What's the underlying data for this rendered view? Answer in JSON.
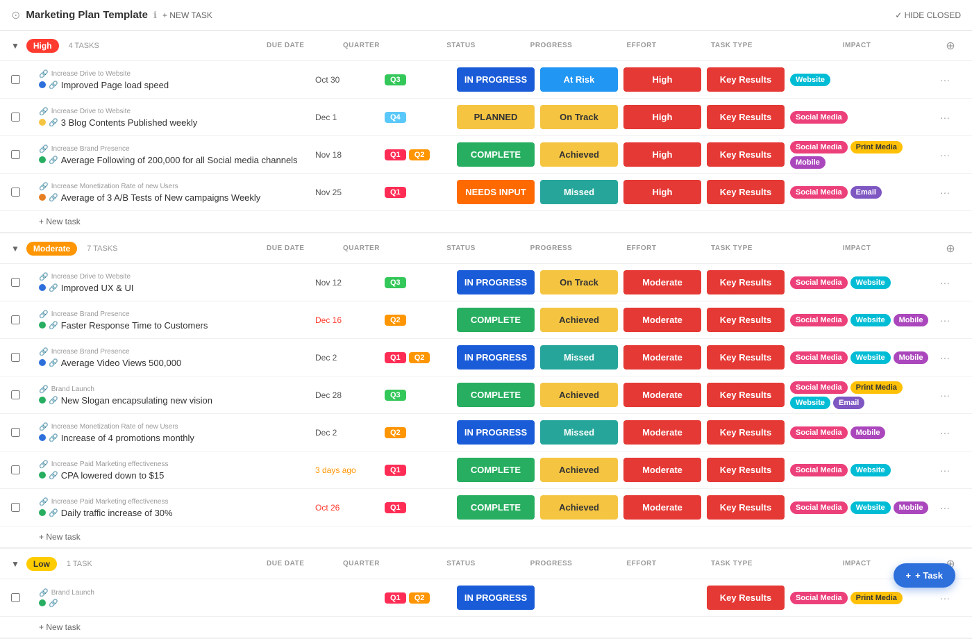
{
  "app": {
    "title": "Marketing Plan Template",
    "new_task_label": "+ NEW TASK",
    "hide_closed_label": "✓ HIDE CLOSED"
  },
  "col_headers": {
    "checkbox": "",
    "task": "",
    "due_date": "DUE DATE",
    "quarter": "QUARTER",
    "status": "STATUS",
    "progress": "PROGRESS",
    "effort": "EFFORT",
    "task_type": "TASK TYPE",
    "impact": "IMPACT",
    "actions": ""
  },
  "groups": [
    {
      "id": "high",
      "label": "High",
      "badge_class": "badge-high",
      "task_count": "4 TASKS",
      "tasks": [
        {
          "parent": "Increase Drive to Website",
          "name": "Improved Page load speed",
          "dot": "dot-blue",
          "due_date": "Oct 30",
          "due_class": "",
          "quarters": [
            {
              "label": "Q3",
              "class": "q3"
            }
          ],
          "status": "IN PROGRESS",
          "status_class": "status-in-progress",
          "progress": "At Risk",
          "progress_class": "prog-at-risk",
          "effort": "High",
          "effort_class": "effort-high",
          "task_type": "Key Results",
          "tt_class": "tt-key-results",
          "impact_tags": [
            {
              "label": "Website",
              "class": "imp-website"
            }
          ]
        },
        {
          "parent": "Increase Drive to Website",
          "name": "3 Blog Contents Published weekly",
          "dot": "dot-yellow",
          "due_date": "Dec 1",
          "due_class": "",
          "quarters": [
            {
              "label": "Q4",
              "class": "q4"
            }
          ],
          "status": "PLANNED",
          "status_class": "status-planned",
          "progress": "On Track",
          "progress_class": "prog-on-track",
          "effort": "High",
          "effort_class": "effort-high",
          "task_type": "Key Results",
          "tt_class": "tt-key-results",
          "impact_tags": [
            {
              "label": "Social Media",
              "class": "imp-social"
            }
          ]
        },
        {
          "parent": "Increase Brand Presence",
          "name": "Average Following of 200,000 for all Social media channels",
          "dot": "dot-green",
          "due_date": "Nov 18",
          "due_class": "",
          "quarters": [
            {
              "label": "Q1",
              "class": "q1"
            },
            {
              "label": "Q2",
              "class": "q2"
            }
          ],
          "status": "COMPLETE",
          "status_class": "status-complete",
          "progress": "Achieved",
          "progress_class": "prog-achieved",
          "effort": "High",
          "effort_class": "effort-high",
          "task_type": "Key Results",
          "tt_class": "tt-key-results",
          "impact_tags": [
            {
              "label": "Social Media",
              "class": "imp-social"
            },
            {
              "label": "Print Media",
              "class": "imp-print"
            },
            {
              "label": "Mobile",
              "class": "imp-mobile"
            }
          ]
        },
        {
          "parent": "Increase Monetization Rate of new Users",
          "name": "Average of 3 A/B Tests of New campaigns Weekly",
          "dot": "dot-orange",
          "due_date": "Nov 25",
          "due_class": "",
          "quarters": [
            {
              "label": "Q1",
              "class": "q1"
            }
          ],
          "status": "NEEDS INPUT",
          "status_class": "status-needs-input",
          "progress": "Missed",
          "progress_class": "prog-missed",
          "effort": "High",
          "effort_class": "effort-high",
          "task_type": "Key Results",
          "tt_class": "tt-key-results",
          "impact_tags": [
            {
              "label": "Social Media",
              "class": "imp-social"
            },
            {
              "label": "Email",
              "class": "imp-email"
            }
          ]
        }
      ]
    },
    {
      "id": "moderate",
      "label": "Moderate",
      "badge_class": "badge-moderate",
      "task_count": "7 TASKS",
      "tasks": [
        {
          "parent": "Increase Drive to Website",
          "name": "Improved UX & UI",
          "dot": "dot-blue",
          "due_date": "Nov 12",
          "due_class": "",
          "quarters": [
            {
              "label": "Q3",
              "class": "q3"
            }
          ],
          "status": "IN PROGRESS",
          "status_class": "status-in-progress",
          "progress": "On Track",
          "progress_class": "prog-on-track",
          "effort": "Moderate",
          "effort_class": "effort-moderate",
          "task_type": "Key Results",
          "tt_class": "tt-key-results",
          "impact_tags": [
            {
              "label": "Social Media",
              "class": "imp-social"
            },
            {
              "label": "Website",
              "class": "imp-website"
            }
          ]
        },
        {
          "parent": "Increase Brand Presence",
          "name": "Faster Response Time to Customers",
          "dot": "dot-green",
          "due_date": "Dec 16",
          "due_class": "overdue",
          "quarters": [
            {
              "label": "Q2",
              "class": "q2"
            }
          ],
          "status": "COMPLETE",
          "status_class": "status-complete",
          "progress": "Achieved",
          "progress_class": "prog-achieved",
          "effort": "Moderate",
          "effort_class": "effort-moderate",
          "task_type": "Key Results",
          "tt_class": "tt-key-results",
          "impact_tags": [
            {
              "label": "Social Media",
              "class": "imp-social"
            },
            {
              "label": "Website",
              "class": "imp-website"
            },
            {
              "label": "Mobile",
              "class": "imp-mobile"
            }
          ]
        },
        {
          "parent": "Increase Brand Presence",
          "name": "Average Video Views 500,000",
          "dot": "dot-blue",
          "due_date": "Dec 2",
          "due_class": "",
          "quarters": [
            {
              "label": "Q1",
              "class": "q1"
            },
            {
              "label": "Q2",
              "class": "q2"
            }
          ],
          "status": "IN PROGRESS",
          "status_class": "status-in-progress",
          "progress": "Missed",
          "progress_class": "prog-missed",
          "effort": "Moderate",
          "effort_class": "effort-moderate",
          "task_type": "Key Results",
          "tt_class": "tt-key-results",
          "impact_tags": [
            {
              "label": "Social Media",
              "class": "imp-social"
            },
            {
              "label": "Website",
              "class": "imp-website"
            },
            {
              "label": "Mobile",
              "class": "imp-mobile"
            }
          ]
        },
        {
          "parent": "Brand Launch",
          "name": "New Slogan encapsulating new vision",
          "dot": "dot-green",
          "due_date": "Dec 28",
          "due_class": "",
          "quarters": [
            {
              "label": "Q3",
              "class": "q3"
            }
          ],
          "status": "COMPLETE",
          "status_class": "status-complete",
          "progress": "Achieved",
          "progress_class": "prog-achieved",
          "effort": "Moderate",
          "effort_class": "effort-moderate",
          "task_type": "Key Results",
          "tt_class": "tt-key-results",
          "impact_tags": [
            {
              "label": "Social Media",
              "class": "imp-social"
            },
            {
              "label": "Print Media",
              "class": "imp-print"
            },
            {
              "label": "Website",
              "class": "imp-website"
            },
            {
              "label": "Email",
              "class": "imp-email"
            }
          ]
        },
        {
          "parent": "Increase Monetization Rate of new Users",
          "name": "Increase of 4 promotions monthly",
          "dot": "dot-blue",
          "due_date": "Dec 2",
          "due_class": "",
          "quarters": [
            {
              "label": "Q2",
              "class": "q2"
            }
          ],
          "status": "IN PROGRESS",
          "status_class": "status-in-progress",
          "progress": "Missed",
          "progress_class": "prog-missed",
          "effort": "Moderate",
          "effort_class": "effort-moderate",
          "task_type": "Key Results",
          "tt_class": "tt-key-results",
          "impact_tags": [
            {
              "label": "Social Media",
              "class": "imp-social"
            },
            {
              "label": "Mobile",
              "class": "imp-mobile"
            }
          ]
        },
        {
          "parent": "Increase Paid Marketing effectiveness",
          "name": "CPA lowered down to $15",
          "dot": "dot-green",
          "due_date": "3 days ago",
          "due_class": "warning",
          "quarters": [
            {
              "label": "Q1",
              "class": "q1"
            }
          ],
          "status": "COMPLETE",
          "status_class": "status-complete",
          "progress": "Achieved",
          "progress_class": "prog-achieved",
          "effort": "Moderate",
          "effort_class": "effort-moderate",
          "task_type": "Key Results",
          "tt_class": "tt-key-results",
          "impact_tags": [
            {
              "label": "Social Media",
              "class": "imp-social"
            },
            {
              "label": "Website",
              "class": "imp-website"
            }
          ]
        },
        {
          "parent": "Increase Paid Marketing effectiveness",
          "name": "Daily traffic increase of 30%",
          "dot": "dot-green",
          "due_date": "Oct 26",
          "due_class": "overdue",
          "quarters": [
            {
              "label": "Q1",
              "class": "q1"
            }
          ],
          "status": "COMPLETE",
          "status_class": "status-complete",
          "progress": "Achieved",
          "progress_class": "prog-achieved",
          "effort": "Moderate",
          "effort_class": "effort-moderate",
          "task_type": "Key Results",
          "tt_class": "tt-key-results",
          "impact_tags": [
            {
              "label": "Social Media",
              "class": "imp-social"
            },
            {
              "label": "Website",
              "class": "imp-website"
            },
            {
              "label": "Mobile",
              "class": "imp-mobile"
            }
          ]
        }
      ]
    },
    {
      "id": "low",
      "label": "Low",
      "badge_class": "badge-low",
      "task_count": "1 TASK",
      "tasks": [
        {
          "parent": "Brand Launch",
          "name": "",
          "dot": "dot-green",
          "due_date": "",
          "due_class": "",
          "quarters": [
            {
              "label": "Q1",
              "class": "q1"
            },
            {
              "label": "Q2",
              "class": "q2"
            }
          ],
          "status": "IN PROGRESS",
          "status_class": "status-in-progress",
          "progress": "",
          "progress_class": "",
          "effort": "",
          "effort_class": "",
          "task_type": "Key Results",
          "tt_class": "tt-key-results",
          "impact_tags": [
            {
              "label": "Social Media",
              "class": "imp-social"
            },
            {
              "label": "Print Media",
              "class": "imp-print"
            }
          ]
        }
      ]
    }
  ],
  "fab": {
    "label": "+ Task"
  }
}
